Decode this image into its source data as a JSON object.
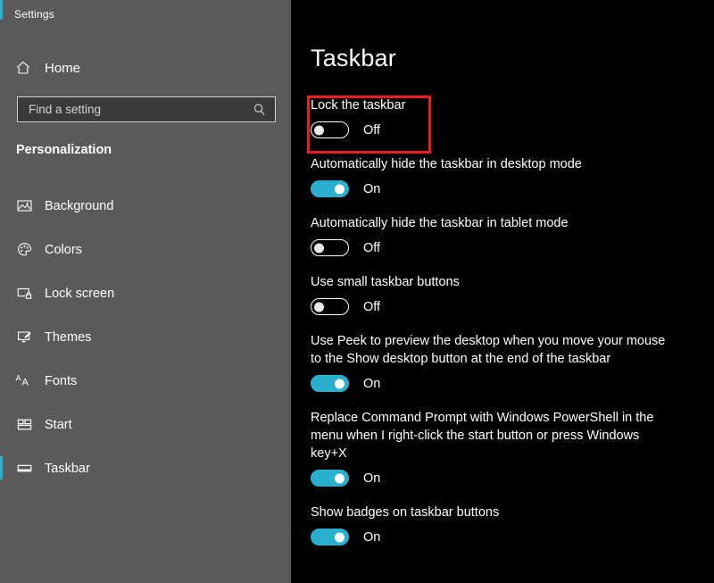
{
  "window": {
    "title": "Settings"
  },
  "sidebar": {
    "home_label": "Home",
    "home_icon": "home-icon",
    "search": {
      "placeholder": "Find a setting",
      "value": "",
      "icon": "search-icon"
    },
    "section_heading": "Personalization",
    "items": [
      {
        "label": "Background",
        "icon": "picture-icon",
        "selected": false
      },
      {
        "label": "Colors",
        "icon": "palette-icon",
        "selected": false
      },
      {
        "label": "Lock screen",
        "icon": "monitor-lock-icon",
        "selected": false
      },
      {
        "label": "Themes",
        "icon": "brush-screen-icon",
        "selected": false
      },
      {
        "label": "Fonts",
        "icon": "font-aa-icon",
        "selected": false
      },
      {
        "label": "Start",
        "icon": "start-tiles-icon",
        "selected": false
      },
      {
        "label": "Taskbar",
        "icon": "taskbar-icon",
        "selected": true
      }
    ]
  },
  "main": {
    "page_title": "Taskbar",
    "settings": [
      {
        "label": "Lock the taskbar",
        "state": "Off",
        "on": false,
        "highlighted": true
      },
      {
        "label": "Automatically hide the taskbar in desktop mode",
        "state": "On",
        "on": true,
        "highlighted": false
      },
      {
        "label": "Automatically hide the taskbar in tablet mode",
        "state": "Off",
        "on": false,
        "highlighted": false
      },
      {
        "label": "Use small taskbar buttons",
        "state": "Off",
        "on": false,
        "highlighted": false
      },
      {
        "label": "Use Peek to preview the desktop when you move your mouse to the Show desktop button at the end of the taskbar",
        "state": "On",
        "on": true,
        "highlighted": false
      },
      {
        "label": "Replace Command Prompt with Windows PowerShell in the menu when I right-click the start button or press Windows key+X",
        "state": "On",
        "on": true,
        "highlighted": false
      },
      {
        "label": "Show badges on taskbar buttons",
        "state": "On",
        "on": true,
        "highlighted": false
      }
    ]
  },
  "colors": {
    "accent": "#28b0cf",
    "sidebar_bg": "#5a5a5a",
    "content_bg": "#000000",
    "highlight_box": "#ee1c1c",
    "toggle_on": "#29b0cf"
  }
}
